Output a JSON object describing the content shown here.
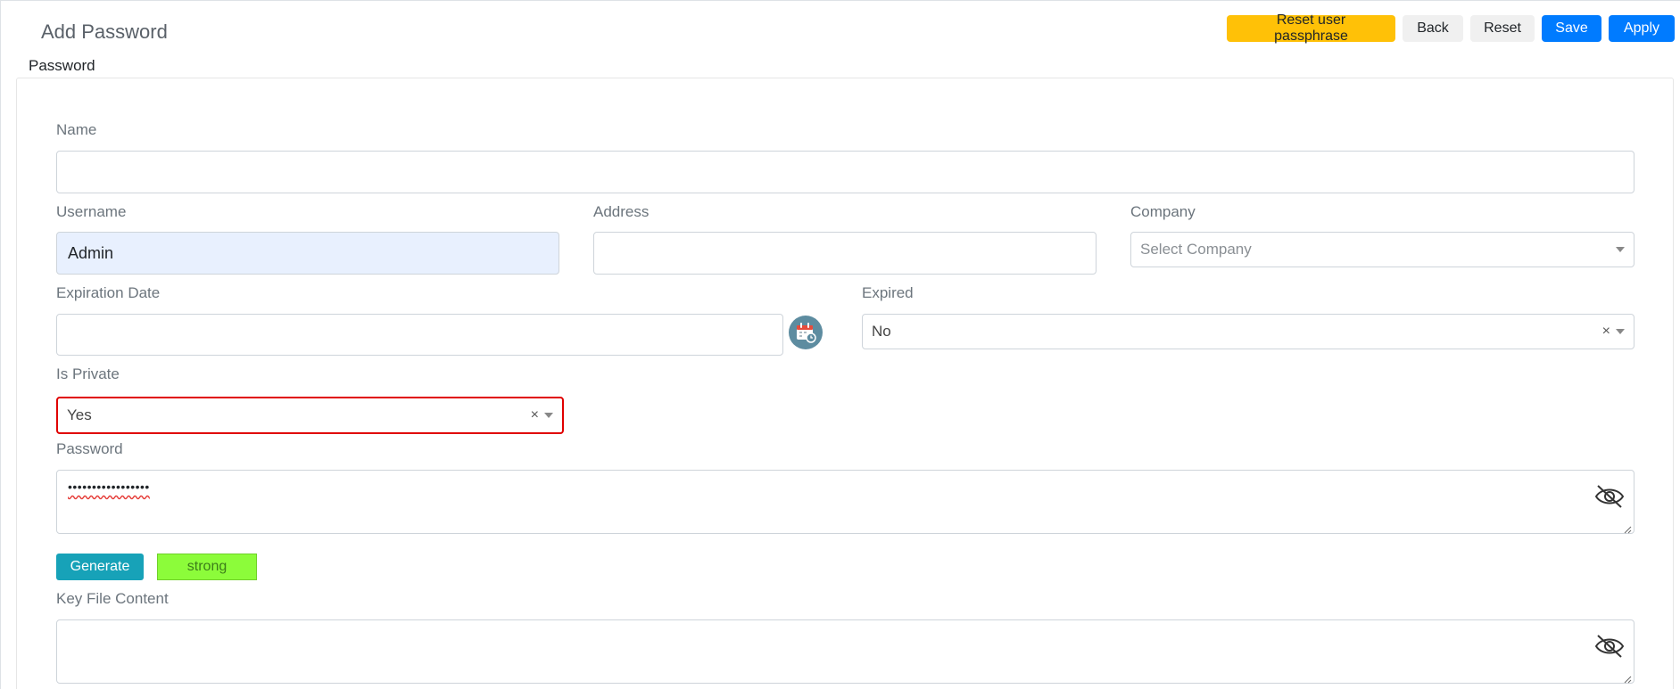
{
  "page": {
    "title": "Add Password",
    "section_title": "Password"
  },
  "toolbar": {
    "reset_passphrase_label": "Reset user passphrase",
    "back_label": "Back",
    "reset_label": "Reset",
    "save_label": "Save",
    "apply_label": "Apply"
  },
  "form": {
    "name": {
      "label": "Name",
      "value": ""
    },
    "username": {
      "label": "Username",
      "value": "Admin"
    },
    "address": {
      "label": "Address",
      "value": ""
    },
    "company": {
      "label": "Company",
      "placeholder": "Select Company"
    },
    "expiration_date": {
      "label": "Expiration Date",
      "value": ""
    },
    "expired": {
      "label": "Expired",
      "value": "No"
    },
    "is_private": {
      "label": "Is Private",
      "value": "Yes"
    },
    "password": {
      "label": "Password",
      "value": "•••••••••••••••••"
    },
    "generate_label": "Generate",
    "strength": "strong",
    "key_file_content": {
      "label": "Key File Content",
      "value": ""
    }
  },
  "icons": {
    "calendar": "calendar-icon",
    "eye_hidden": "eye-slash-icon",
    "clear": "×"
  },
  "colors": {
    "primary": "#007bff",
    "warning": "#ffc107",
    "info": "#17a2b8",
    "strength": "#8cfc3a",
    "highlight": "#e00000"
  }
}
